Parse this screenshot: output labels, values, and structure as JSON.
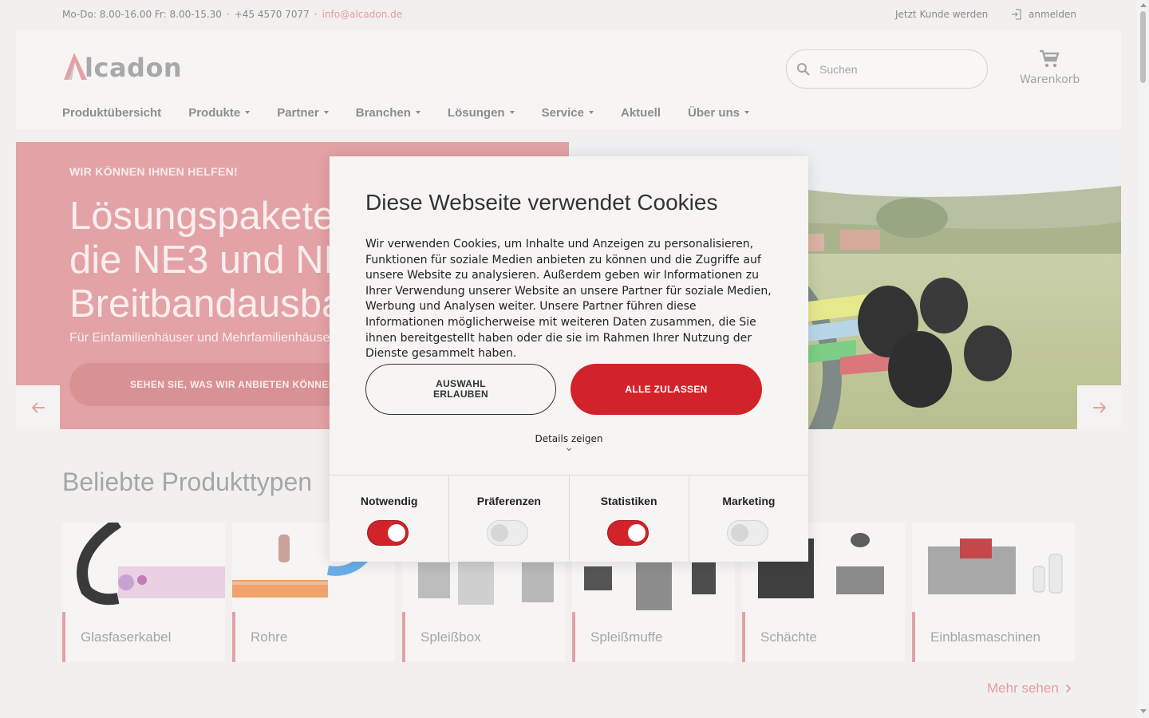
{
  "topbar": {
    "hours": "Mo-Do: 8.00-16.00 Fr: 8.00-15.30",
    "separator": "·",
    "phone": "+45 4570 7077",
    "email": "info@alcadon.de",
    "become_customer": "Jetzt Kunde werden",
    "login": "anmelden"
  },
  "brand": {
    "name": "Alcadon",
    "mark_letter": "A",
    "word_rest": "lcadon",
    "color": "#e3a2a5"
  },
  "header": {
    "search_placeholder": "Suchen",
    "cart_label": "Warenkorb"
  },
  "nav": [
    {
      "label": "Produktübersicht",
      "dropdown": false
    },
    {
      "label": "Produkte",
      "dropdown": true
    },
    {
      "label": "Partner",
      "dropdown": true
    },
    {
      "label": "Branchen",
      "dropdown": true
    },
    {
      "label": "Lösungen",
      "dropdown": true
    },
    {
      "label": "Service",
      "dropdown": true
    },
    {
      "label": "Aktuell",
      "dropdown": false
    },
    {
      "label": "Über uns",
      "dropdown": true
    }
  ],
  "hero": {
    "eyebrow": "WIR KÖNNEN IHNEN HELFEN!",
    "headline": "Lösungspakete für\ndie NE3 und NE4 im\nBreitbandausbau",
    "sub": "Für Einfamilienhäuser und Mehrfamilienhäuser",
    "cta": "SEHEN SIE, WAS WIR ANBIETEN KÖNNEN"
  },
  "products": {
    "title": "Beliebte Produkttypen",
    "items": [
      {
        "label": "Glasfaserkabel"
      },
      {
        "label": "Rohre"
      },
      {
        "label": "Spleißbox"
      },
      {
        "label": "Spleißmuffe"
      },
      {
        "label": "Schächte"
      },
      {
        "label": "Einblasmaschinen"
      }
    ],
    "more": "Mehr sehen"
  },
  "cookie": {
    "title": "Diese Webseite verwendet Cookies",
    "body": "Wir verwenden Cookies, um Inhalte und Anzeigen zu personalisieren, Funktionen für soziale Medien anbieten zu können und die Zugriffe auf unsere Website zu analysieren. Außerdem geben wir Informationen zu Ihrer Verwendung unserer Website an unsere Partner für soziale Medien, Werbung und Analysen weiter. Unsere Partner führen diese Informationen möglicherweise mit weiteren Daten zusammen, die Sie ihnen bereitgestellt haben oder die sie im Rahmen Ihrer Nutzung der Dienste gesammelt haben.",
    "btn_selection": "AUSWAHL ERLAUBEN",
    "btn_all": "ALLE ZULASSEN",
    "details": "Details zeigen",
    "toggles": [
      {
        "label": "Notwendig",
        "on": true
      },
      {
        "label": "Präferenzen",
        "on": false
      },
      {
        "label": "Statistiken",
        "on": true
      },
      {
        "label": "Marketing",
        "on": false
      }
    ],
    "accent": "#d2232a"
  }
}
